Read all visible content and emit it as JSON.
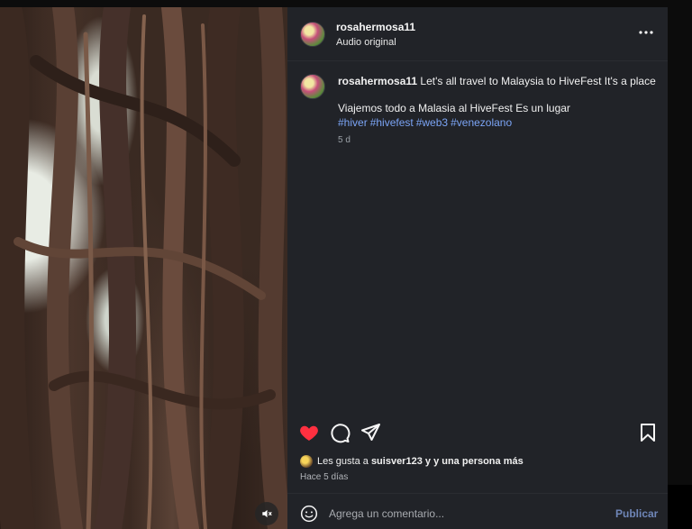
{
  "post": {
    "username": "rosahermosa11",
    "audio": "Audio original"
  },
  "comment": {
    "username": "rosahermosa11",
    "text": "Let's all travel to Malaysia to HiveFest It's a place",
    "text2": "Viajemos todo a Malasia al HiveFest Es un lugar",
    "tags": [
      "#hiver",
      "#hivefest",
      "#web3",
      "#venezolano"
    ],
    "time": "5 d"
  },
  "likes": {
    "prefix": "Les gusta a",
    "user": "suisver123",
    "suffix": "y y una persona más"
  },
  "posted_ago": "Hace 5 días",
  "add_comment": {
    "placeholder": "Agrega un comentario...",
    "publish_label": "Publicar"
  },
  "icons": {
    "like": "heart-icon-filled",
    "comment": "comment-icon",
    "share": "send-icon",
    "save": "bookmark-icon",
    "more": "more-horizontal-icon",
    "mute": "speaker-muted-icon",
    "emoji": "smiley-icon"
  },
  "colors": {
    "panel_bg": "#212328",
    "like_red": "#ff3040",
    "hashtag": "#7ba4f5",
    "publish": "#6f86b8"
  }
}
